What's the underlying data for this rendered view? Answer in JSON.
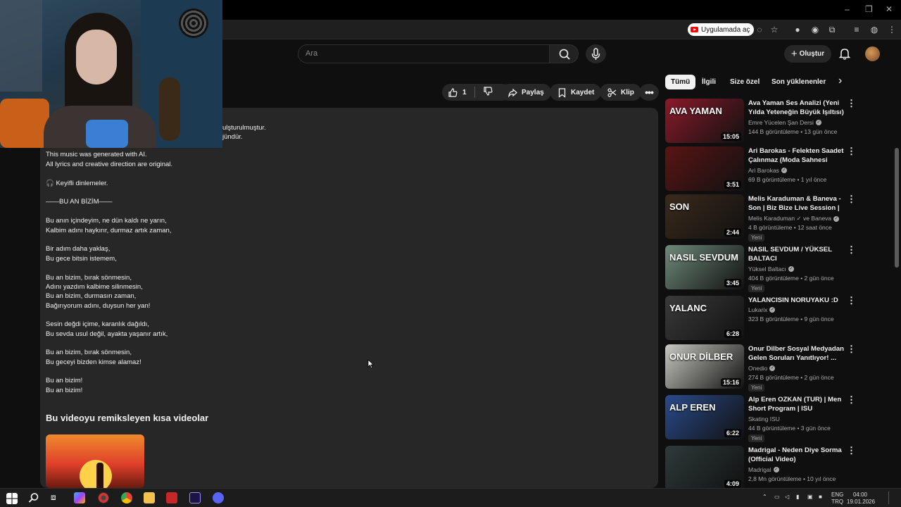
{
  "browser": {
    "open_in_app_label": "Uygulamada aç",
    "window_controls": [
      "–",
      "❐",
      "✕"
    ]
  },
  "header": {
    "search_placeholder": "Ara",
    "create_label": "Oluştur"
  },
  "actions": {
    "like_count": "1",
    "share_label": "Paylaş",
    "save_label": "Kaydet",
    "clip_label": "Klip"
  },
  "description": {
    "partial_line1": "ulşturulmuştur.",
    "partial_line2": "jündür.",
    "lines": [
      "This music was generated with AI.",
      "All lyrics and creative direction are original.",
      "🎧 Keyifli dinlemeler.",
      "——BU AN BİZİM——",
      "Bu anın içindeyim, ne dün kaldı ne yarın,",
      "Kalbim adını haykırır, durmaz artık zaman,",
      "Bir adım daha yaklaş,",
      "Bu gece bitsin istemem,",
      "Bu an bizim, bırak sönmesin,",
      "Adını yazdım kalbime silinmesin,",
      "Bu an bizim, durmasın zaman,",
      "Bağırıyorum adını, duysun her yan!",
      "Sesin değdi içime, karanlık dağıldı,",
      "Bu sevda usul değil, ayakta yaşanır artık,",
      "Bu an bizim, bırak sönmesin,",
      "Bu geceyi bizden kimse alamaz!",
      "Bu an bizim!",
      "Bu an bizim!"
    ],
    "shorts_title": "Bu videoyu remiksleyen kısa videolar"
  },
  "chips": [
    "Tümü",
    "İlgili",
    "Size özel",
    "Son yüklenenler"
  ],
  "recommendations": [
    {
      "title": "Ava Yaman Ses Analizi (Yeni Yılda Yeteneğin Büyük Işıltısı)",
      "channel": "Emre Yücelen Şan Dersi",
      "verified": true,
      "meta": "144 B görüntüleme • 13 gün önce",
      "duration": "15:05",
      "new": "",
      "thumb_color": "#8a1a2a",
      "thumb_text": "AVA YAMAN"
    },
    {
      "title": "Ari Barokas - Felekten Saadet Çalınmaz (Moda Sahnesi Canlı...",
      "channel": "Ari Barokas",
      "verified": true,
      "meta": "69 B görüntüleme • 1 yıl önce",
      "duration": "3:51",
      "new": "",
      "thumb_color": "#5a1414",
      "thumb_text": ""
    },
    {
      "title": "Melis Karaduman & Baneva - Son | Biz Bize Live Session | ...",
      "channel": "Melis Karaduman ✓ ve Baneva",
      "verified": true,
      "meta": "4 B görüntüleme • 12 saat önce",
      "duration": "2:44",
      "new": "Yeni",
      "thumb_color": "#3a2a1c",
      "thumb_text": "SON"
    },
    {
      "title": "NASIL SEVDUM / YÜKSEL BALTACI",
      "channel": "Yüksel Baltacı",
      "verified": true,
      "meta": "404 B görüntüleme • 2 gün önce",
      "duration": "3:45",
      "new": "Yeni",
      "thumb_color": "#6f8a7a",
      "thumb_text": "NASIL SEVDUM"
    },
    {
      "title": "YALANCISIN NORUYAKU :D",
      "channel": "Lukarix",
      "verified": true,
      "meta": "323 B görüntüleme • 9 gün önce",
      "duration": "6:28",
      "new": "",
      "thumb_color": "#3a3a3a",
      "thumb_text": "YALANC"
    },
    {
      "title": "Onur Dilber Sosyal Medyadan Gelen Soruları Yanıtlıyor! ...",
      "channel": "Onedio",
      "verified": true,
      "meta": "274 B görüntüleme • 2 gün önce",
      "duration": "15:16",
      "new": "Yeni",
      "thumb_color": "#c9c9c2",
      "thumb_text": "ONUR DİLBER"
    },
    {
      "title": "Alp Eren OZKAN (TUR) | Men Short Program | ISU European ...",
      "channel": "Skating ISU",
      "verified": false,
      "meta": "44 B görüntüleme • 3 gün önce",
      "duration": "6:22",
      "new": "Yeni",
      "thumb_color": "#2a4a8a",
      "thumb_text": "ALP EREN"
    },
    {
      "title": "Madrigal - Neden Diye Sorma (Official Video)",
      "channel": "Madrigal",
      "verified": true,
      "meta": "2,8 Mn görüntüleme • 10 yıl önce",
      "duration": "4:09",
      "new": "",
      "thumb_color": "#2e3a3a",
      "thumb_text": ""
    }
  ],
  "taskbar": {
    "lang": "ENG",
    "region": "TRQ",
    "time": "04:00",
    "date": "19.01.2026"
  }
}
